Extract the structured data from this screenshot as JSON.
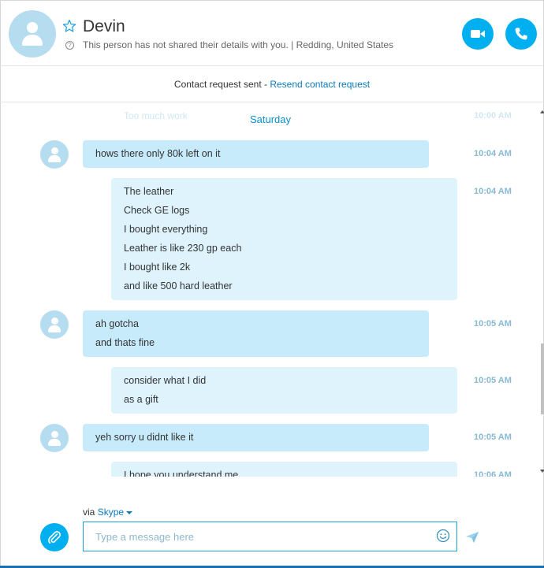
{
  "header": {
    "name": "Devin",
    "details": "This person has not shared their details with you.  |  Redding, United States",
    "info_glyph": "?"
  },
  "request": {
    "text": "Contact request sent - ",
    "link": "Resend contact request"
  },
  "conversation": {
    "faded_top_message": "Too much work",
    "faded_top_time": "10:00 AM",
    "day_separator": "Saturday",
    "messages": [
      {
        "direction": "in",
        "lines": [
          "hows there only 80k left on it"
        ],
        "time": "10:04 AM"
      },
      {
        "direction": "out",
        "lines": [
          "The leather",
          "Check GE logs",
          "I bought everything",
          "Leather is like 230 gp each",
          "I bought like 2k",
          "and like 500 hard leather"
        ],
        "time": "10:04 AM"
      },
      {
        "direction": "in",
        "lines": [
          "ah gotcha",
          "and thats fine"
        ],
        "time": "10:05 AM"
      },
      {
        "direction": "out",
        "lines": [
          "consider what I did",
          "as a gift"
        ],
        "time": "10:05 AM"
      },
      {
        "direction": "in",
        "lines": [
          "yeh sorry u didnt like it"
        ],
        "time": "10:05 AM"
      },
      {
        "direction": "out",
        "lines": [
          "I hope you understand me"
        ],
        "time": "10:06 AM"
      }
    ]
  },
  "compose": {
    "via_label": "via ",
    "via_service": "Skype",
    "placeholder": "Type a message here"
  },
  "icons": {
    "star": "star-icon",
    "video": "video-camera-icon",
    "phone": "phone-icon",
    "attach": "paperclip-icon",
    "emoji": "smiley-icon",
    "send": "send-icon"
  },
  "colors": {
    "accent": "#00aff0",
    "incoming_bubble": "#c7ebfa",
    "outgoing_bubble": "#dff3fc",
    "link": "#0a7bb8",
    "timestamp": "#86b9d2"
  }
}
